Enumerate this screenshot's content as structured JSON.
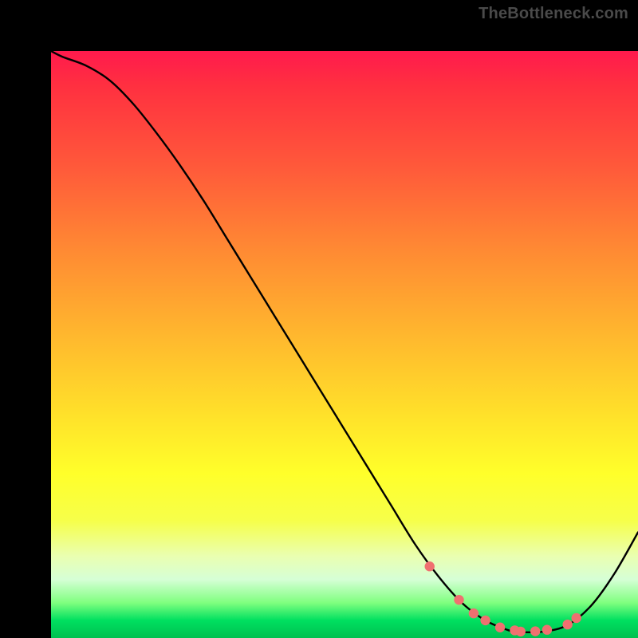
{
  "watermark": "TheBottleneck.com",
  "chart_data": {
    "type": "line",
    "title": "",
    "xlabel": "",
    "ylabel": "",
    "xlim": [
      0,
      100
    ],
    "ylim": [
      0,
      100
    ],
    "series": [
      {
        "name": "curve",
        "x": [
          0,
          2,
          6,
          10,
          14,
          18,
          22,
          26,
          30,
          34,
          38,
          42,
          46,
          50,
          54,
          58,
          62,
          66,
          70,
          74,
          78,
          80,
          84,
          88,
          92,
          96,
          100
        ],
        "y": [
          100,
          99,
          97.5,
          95,
          91,
          86,
          80.5,
          74.5,
          68,
          61.5,
          55,
          48.5,
          42,
          35.5,
          29,
          22.5,
          16,
          10.5,
          6,
          3,
          1.3,
          1,
          1.1,
          2.2,
          5.5,
          11,
          18
        ]
      }
    ],
    "markers": {
      "name": "dots",
      "x": [
        64.5,
        69.5,
        72,
        74,
        76.5,
        79,
        80,
        82.5,
        84.5,
        88,
        89.5
      ],
      "y": [
        12.2,
        6.5,
        4.2,
        3.0,
        1.8,
        1.3,
        1.1,
        1.15,
        1.4,
        2.3,
        3.4
      ]
    },
    "colors": {
      "line": "#000000",
      "marker_fill": "#f07070",
      "marker_stroke": "#c94a4a"
    }
  }
}
